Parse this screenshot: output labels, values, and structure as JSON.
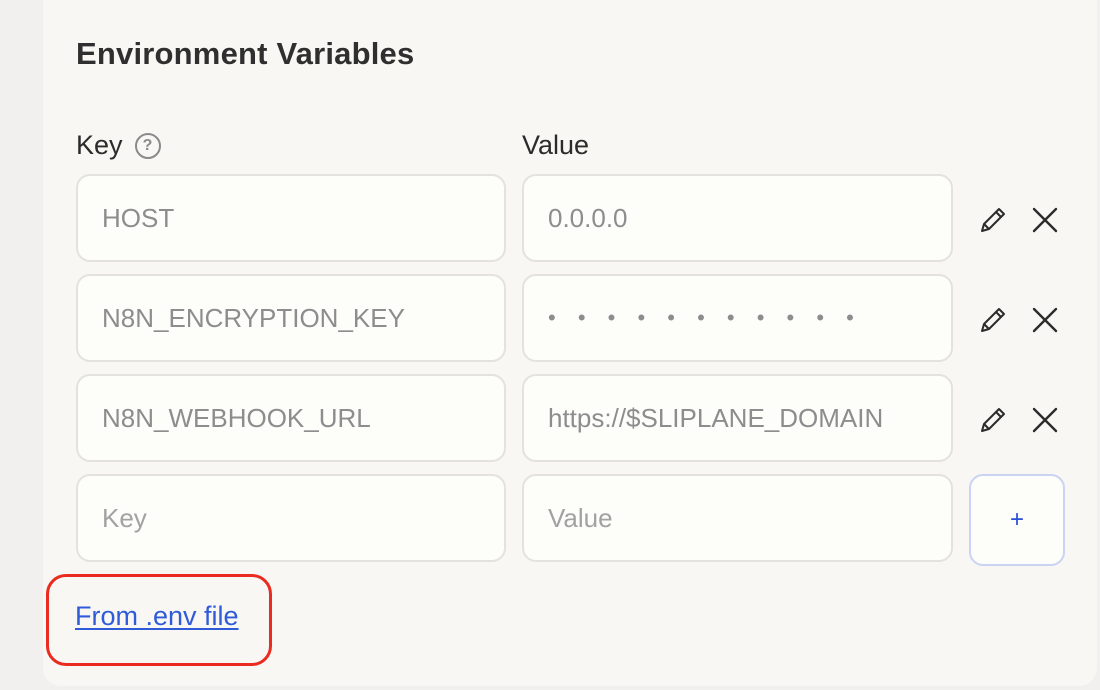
{
  "section": {
    "title": "Environment Variables",
    "key_label": "Key",
    "value_label": "Value",
    "help_icon": "?"
  },
  "rows": [
    {
      "key": "HOST",
      "value": "0.0.0.0"
    },
    {
      "key": "N8N_ENCRYPTION_KEY",
      "value": "• • • • • • • • • • •"
    },
    {
      "key": "N8N_WEBHOOK_URL",
      "value": "https://$SLIPLANE_DOMAIN"
    }
  ],
  "new_row": {
    "key_placeholder": "Key",
    "value_placeholder": "Value",
    "add_label": "+"
  },
  "links": {
    "from_env_file": "From .env file"
  },
  "icons": {
    "edit": "pencil-icon",
    "delete": "close-icon",
    "help": "question-circle-icon"
  },
  "colors": {
    "link": "#2f5bd8",
    "highlight": "#ea2b20",
    "add_border": "#cbd3f3"
  }
}
